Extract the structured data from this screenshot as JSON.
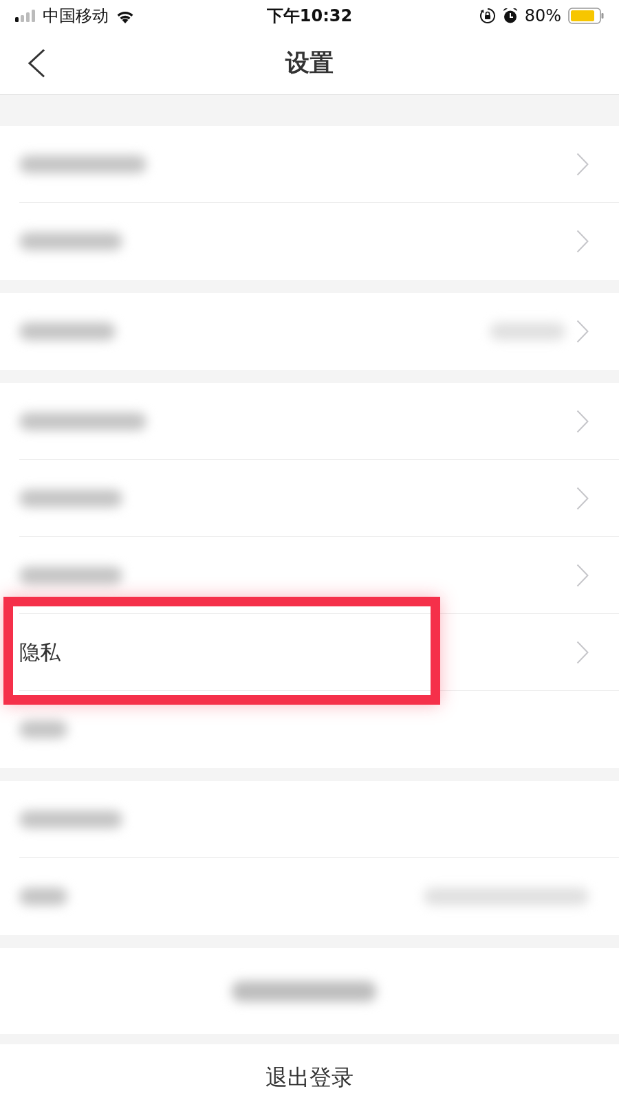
{
  "status_bar": {
    "carrier": "中国移动",
    "time": "下午10:32",
    "battery": "80%"
  },
  "nav": {
    "title": "设置"
  },
  "groups": [
    {
      "rows": [
        {
          "kind": "blurred",
          "value_blurred": false,
          "chevron": true,
          "highlighted": false
        },
        {
          "kind": "blurred",
          "value_blurred": false,
          "chevron": true,
          "highlighted": false
        }
      ]
    },
    {
      "rows": [
        {
          "kind": "blurred",
          "value_blurred": true,
          "chevron": true,
          "highlighted": false
        }
      ]
    },
    {
      "rows": [
        {
          "kind": "blurred",
          "value_blurred": false,
          "chevron": true,
          "highlighted": false
        },
        {
          "kind": "blurred",
          "value_blurred": false,
          "chevron": true,
          "highlighted": false
        },
        {
          "kind": "blurred",
          "value_blurred": false,
          "chevron": true,
          "highlighted": false
        },
        {
          "kind": "text",
          "label": "隐私",
          "value_blurred": false,
          "chevron": true,
          "highlighted": true
        },
        {
          "kind": "blurred",
          "value_blurred": false,
          "chevron": false,
          "highlighted": false
        }
      ]
    },
    {
      "rows": [
        {
          "kind": "blurred",
          "value_blurred": false,
          "chevron": false,
          "highlighted": false
        },
        {
          "kind": "blurred",
          "value_blurred": true,
          "chevron": false,
          "highlighted": false
        }
      ]
    },
    {
      "rows": [
        {
          "kind": "blurred_button"
        }
      ]
    }
  ],
  "logout_button": {
    "label": "退出登录"
  }
}
